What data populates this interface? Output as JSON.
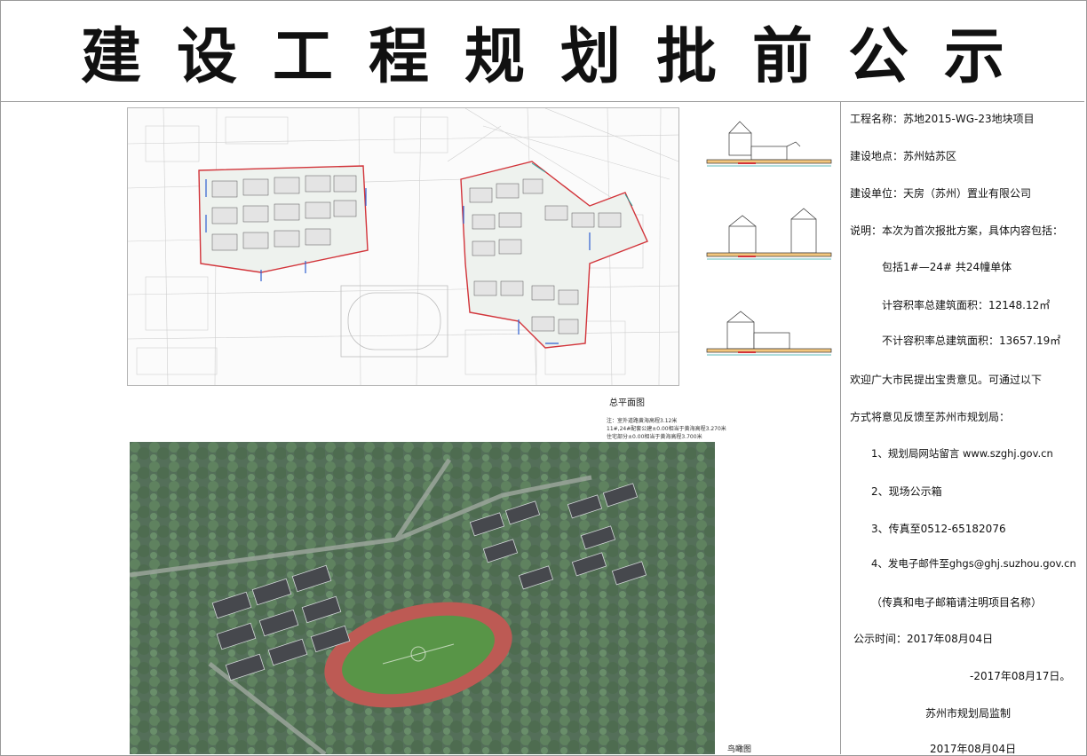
{
  "title": "建设工程规划批前公示",
  "plan": {
    "caption": "总平面图",
    "notes": [
      "注：室外道路黄海高程3.12米",
      "11#,24#配套公建±0.00相当于黄海高程3.270米",
      "住宅部分±0.00相当于黄海高程3.700米"
    ]
  },
  "aerial": {
    "caption": "鸟瞰图"
  },
  "info": {
    "project_name": "工程名称：苏地2015-WG-23地块项目",
    "location": "建设地点：苏州姑苏区",
    "unit": "建设单位：天房（苏州）置业有限公司",
    "desc": "说明：本次为首次报批方案，具体内容包括：",
    "buildings": "包括1#—24# 共24幢单体",
    "far_area": "计容积率总建筑面积：12148.12㎡",
    "nonfar_area": "不计容积率总建筑面积：13657.19㎡",
    "welcome": "欢迎广大市民提出宝贵意见。可通过以下",
    "method": "方式将意见反馈至苏州市规划局：",
    "opt1": "1、规划局网站留言 www.szghj.gov.cn",
    "opt2": "2、现场公示箱",
    "opt3": "3、传真至0512-65182076",
    "opt4": "4、发电子邮件至ghgs@ghj.suzhou.gov.cn",
    "opt_note": "（传真和电子邮箱请注明项目名称）",
    "period_start": "公示时间：2017年08月04日",
    "period_end": "-2017年08月17日。",
    "supervisor": "苏州市规划局监制",
    "date": "2017年08月04日"
  },
  "colors": {
    "border": "#9a9a9a",
    "red_line": "#d2343a",
    "blue_line": "#2f5fd0",
    "track": "#b9504a",
    "field": "#4e8f3c",
    "tree": "#3d6b35"
  }
}
